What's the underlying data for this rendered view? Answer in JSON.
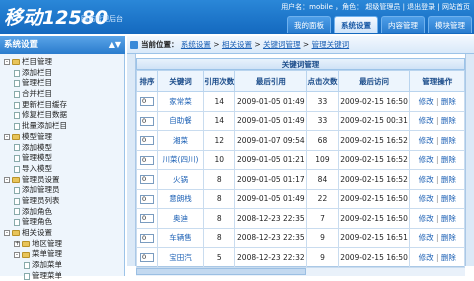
{
  "header": {
    "logo_text": "移动12580",
    "logo_sub": "网站管理后台",
    "user_line": "用户名：mobile ，角色： 超级管理员 | 退出登录 | 网站首页",
    "tabs": [
      {
        "label": "我的面板",
        "active": false
      },
      {
        "label": "系统设置",
        "active": true
      },
      {
        "label": "内容管理",
        "active": false
      },
      {
        "label": "模块管理",
        "active": false
      }
    ]
  },
  "sidebar": {
    "title": "系统设置",
    "items": [
      {
        "label": "栏目管理",
        "level": 0,
        "type": "folder",
        "toggle": "-"
      },
      {
        "label": "添加栏目",
        "level": 1,
        "type": "page"
      },
      {
        "label": "管理栏目",
        "level": 1,
        "type": "page"
      },
      {
        "label": "合并栏目",
        "level": 1,
        "type": "page"
      },
      {
        "label": "更新栏目缓存",
        "level": 1,
        "type": "page"
      },
      {
        "label": "修复栏目数据",
        "level": 1,
        "type": "page"
      },
      {
        "label": "批量添加栏目",
        "level": 1,
        "type": "page"
      },
      {
        "label": "模型管理",
        "level": 0,
        "type": "folder",
        "toggle": "-"
      },
      {
        "label": "添加模型",
        "level": 1,
        "type": "page"
      },
      {
        "label": "管理模型",
        "level": 1,
        "type": "page"
      },
      {
        "label": "导入模型",
        "level": 1,
        "type": "page"
      },
      {
        "label": "管理员设置",
        "level": 0,
        "type": "folder",
        "toggle": "-"
      },
      {
        "label": "添加管理员",
        "level": 1,
        "type": "page"
      },
      {
        "label": "管理员列表",
        "level": 1,
        "type": "page"
      },
      {
        "label": "添加角色",
        "level": 1,
        "type": "page"
      },
      {
        "label": "管理角色",
        "level": 1,
        "type": "page"
      },
      {
        "label": "相关设置",
        "level": 0,
        "type": "folder",
        "toggle": "-"
      },
      {
        "label": "地区管理",
        "level": 1,
        "type": "folder",
        "toggle": "+"
      },
      {
        "label": "菜单管理",
        "level": 1,
        "type": "folder",
        "toggle": "-"
      },
      {
        "label": "添加菜单",
        "level": 2,
        "type": "page"
      },
      {
        "label": "管理菜单",
        "level": 2,
        "type": "page"
      }
    ]
  },
  "breadcrumb": {
    "label": "当前位置：",
    "items": [
      "系统设置",
      "相关设置",
      "关键词管理",
      "管理关键词"
    ],
    "separator": " > "
  },
  "table": {
    "caption": "关键词管理",
    "headers": [
      "排序",
      "关键词",
      "引用次数",
      "最后引用",
      "点击次数",
      "最后访问",
      "管理操作"
    ],
    "rows": [
      {
        "sort": "0",
        "keyword": "家常菜",
        "refs": "14",
        "last_ref": "2009-01-05 01:49",
        "clicks": "33",
        "last_visit": "2009-02-15 16:50",
        "edit": "修改",
        "del": "删除"
      },
      {
        "sort": "0",
        "keyword": "自助餐",
        "refs": "14",
        "last_ref": "2009-01-05 01:49",
        "clicks": "33",
        "last_visit": "2009-02-15 00:31",
        "edit": "修改",
        "del": "删除"
      },
      {
        "sort": "0",
        "keyword": "湘菜",
        "refs": "12",
        "last_ref": "2009-01-07 09:54",
        "clicks": "68",
        "last_visit": "2009-02-15 16:52",
        "edit": "修改",
        "del": "删除"
      },
      {
        "sort": "0",
        "keyword": "川菜(四川)",
        "refs": "10",
        "last_ref": "2009-01-05 01:21",
        "clicks": "109",
        "last_visit": "2009-02-15 16:52",
        "edit": "修改",
        "del": "删除"
      },
      {
        "sort": "0",
        "keyword": "火锅",
        "refs": "8",
        "last_ref": "2009-01-05 01:17",
        "clicks": "84",
        "last_visit": "2009-02-15 16:52",
        "edit": "修改",
        "del": "删除"
      },
      {
        "sort": "0",
        "keyword": "意朗栈",
        "refs": "8",
        "last_ref": "2009-01-05 01:49",
        "clicks": "22",
        "last_visit": "2009-02-15 16:50",
        "edit": "修改",
        "del": "删除"
      },
      {
        "sort": "0",
        "keyword": "奥迪",
        "refs": "8",
        "last_ref": "2008-12-23 22:35",
        "clicks": "7",
        "last_visit": "2009-02-15 16:50",
        "edit": "修改",
        "del": "删除"
      },
      {
        "sort": "0",
        "keyword": "车辆售",
        "refs": "8",
        "last_ref": "2008-12-23 22:35",
        "clicks": "9",
        "last_visit": "2009-02-15 16:51",
        "edit": "修改",
        "del": "删除"
      },
      {
        "sort": "0",
        "keyword": "宝田汽",
        "refs": "5",
        "last_ref": "2008-12-23 22:32",
        "clicks": "9",
        "last_visit": "2009-02-15 16:50",
        "edit": "修改",
        "del": "删除"
      }
    ]
  }
}
